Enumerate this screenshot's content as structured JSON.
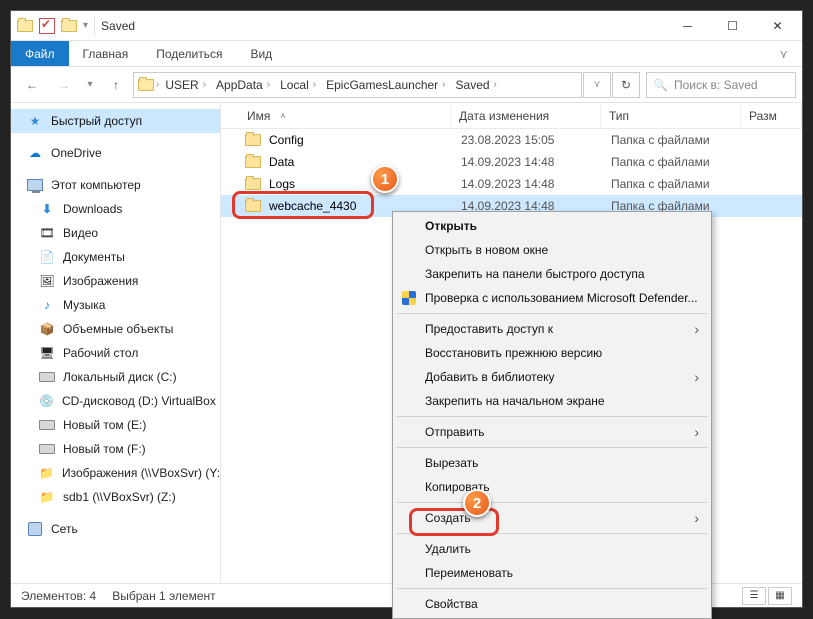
{
  "window": {
    "title": "Saved"
  },
  "ribbon": {
    "file": "Файл",
    "home": "Главная",
    "share": "Поделиться",
    "view": "Вид"
  },
  "breadcrumbs": [
    "USER",
    "AppData",
    "Local",
    "EpicGamesLauncher",
    "Saved"
  ],
  "search": {
    "placeholder": "Поиск в: Saved"
  },
  "columns": {
    "name": "Имя",
    "date": "Дата изменения",
    "type": "Тип",
    "size": "Разм"
  },
  "sidebar": {
    "quick": "Быстрый доступ",
    "onedrive": "OneDrive",
    "this_pc": "Этот компьютер",
    "items": [
      "Downloads",
      "Видео",
      "Документы",
      "Изображения",
      "Музыка",
      "Объемные объекты",
      "Рабочий стол",
      "Локальный диск (C:)",
      "CD-дисковод (D:) VirtualBox",
      "Новый том (E:)",
      "Новый том (F:)",
      "Изображения (\\\\VBoxSvr) (Y:)",
      "sdb1 (\\\\VBoxSvr) (Z:)"
    ],
    "network": "Сеть"
  },
  "rows": [
    {
      "name": "Config",
      "date": "23.08.2023 15:05",
      "type": "Папка с файлами"
    },
    {
      "name": "Data",
      "date": "14.09.2023 14:48",
      "type": "Папка с файлами"
    },
    {
      "name": "Logs",
      "date": "14.09.2023 14:48",
      "type": "Папка с файлами"
    },
    {
      "name": "webcache_4430",
      "date": "14.09.2023 14:48",
      "type": "Папка с файлами"
    }
  ],
  "context_menu": {
    "open": "Открыть",
    "open_new": "Открыть в новом окне",
    "pin_quick": "Закрепить на панели быстрого доступа",
    "defender": "Проверка с использованием Microsoft Defender...",
    "give_access": "Предоставить доступ к",
    "restore": "Восстановить прежнюю версию",
    "add_lib": "Добавить в библиотеку",
    "pin_start": "Закрепить на начальном экране",
    "send_to": "Отправить",
    "cut": "Вырезать",
    "copy": "Копировать",
    "create": "Создать",
    "delete": "Удалить",
    "rename": "Переименовать",
    "props": "Свойства"
  },
  "status": {
    "elements_label": "Элементов:",
    "elements_count": "4",
    "selected": "Выбран 1 элемент"
  }
}
